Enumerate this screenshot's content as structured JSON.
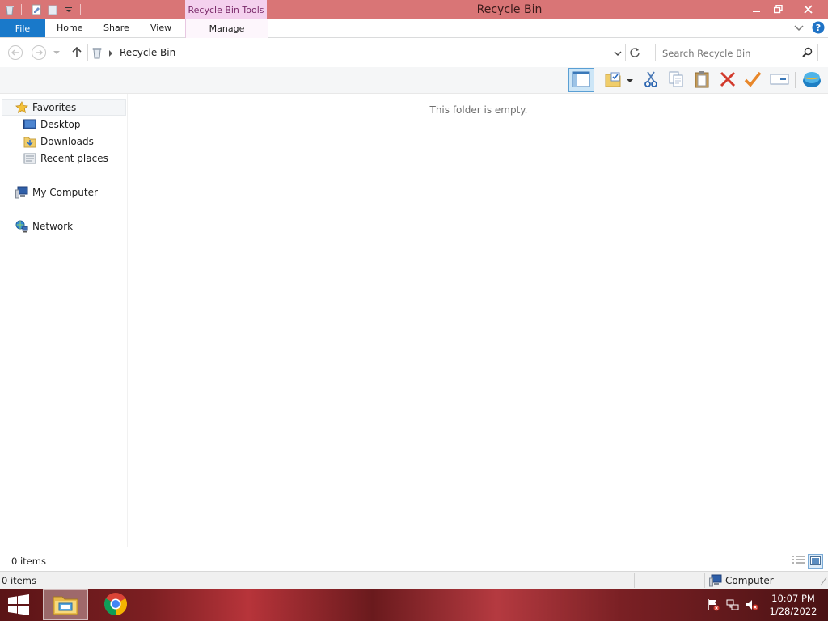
{
  "window": {
    "title": "Recycle Bin",
    "context_tab_group": "Recycle Bin Tools"
  },
  "ribbon": {
    "tabs": [
      "File",
      "Home",
      "Share",
      "View",
      "Manage"
    ]
  },
  "address": {
    "path": "Recycle Bin",
    "search_placeholder": "Search Recycle Bin"
  },
  "toolbar": {
    "icons": [
      "preview-pane-icon",
      "folder-check-icon",
      "cut-icon",
      "copy-icon",
      "paste-icon",
      "delete-icon",
      "check-icon",
      "rename-icon",
      "globe-icon"
    ]
  },
  "navpane": {
    "favorites": "Favorites",
    "desktop": "Desktop",
    "downloads": "Downloads",
    "recent": "Recent places",
    "computer": "My Computer",
    "network": "Network"
  },
  "content": {
    "empty_message": "This folder is empty."
  },
  "status": {
    "item_count": "0 items",
    "bottom_count": "0 items",
    "zone": "Computer"
  },
  "taskbar": {
    "time": "10:07 PM",
    "date": "1/28/2022"
  },
  "colors": {
    "titlebar": "#d97576",
    "file_tab": "#1979ca",
    "context_tab": "#f4d1ee"
  }
}
